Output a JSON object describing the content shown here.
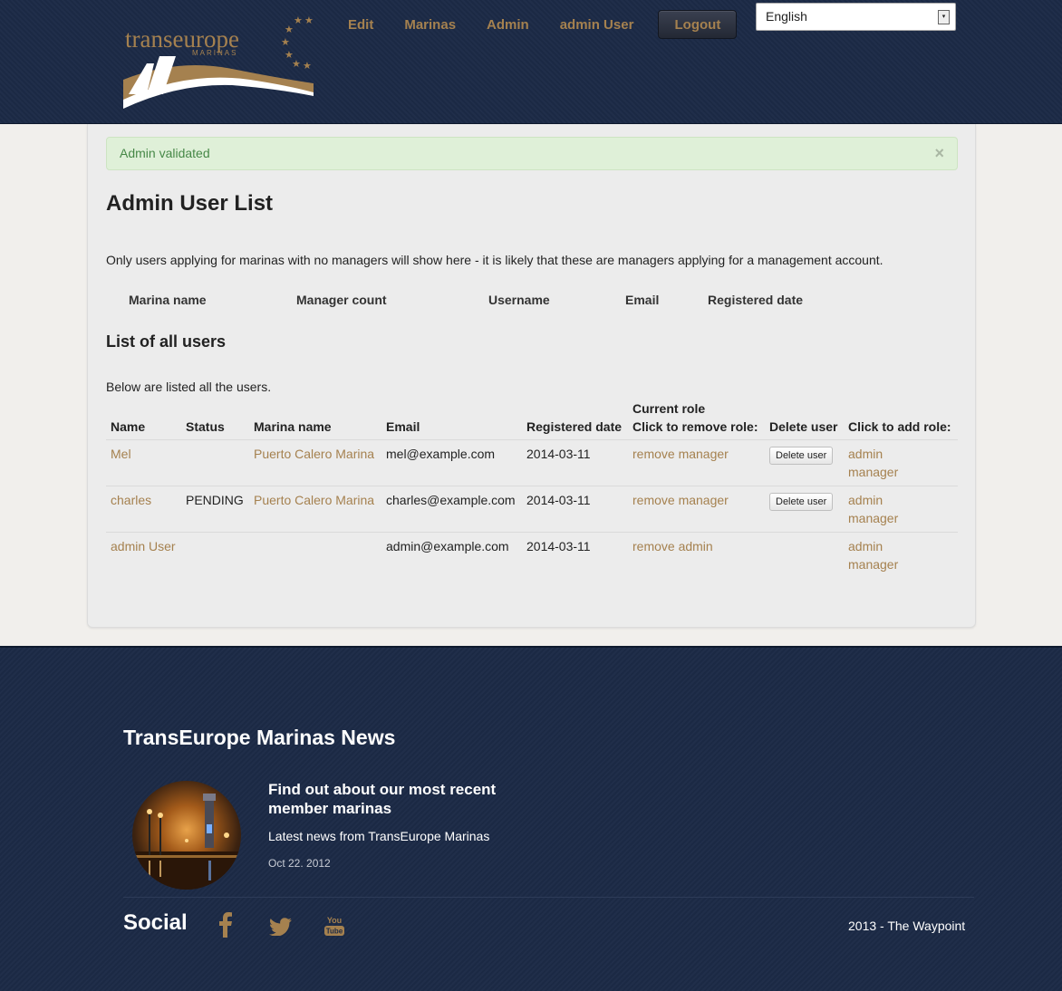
{
  "header": {
    "logo": {
      "main": "transeurope",
      "sub": "MARINAS"
    },
    "nav": [
      "Edit",
      "Marinas",
      "Admin",
      "admin User"
    ],
    "logout_label": "Logout",
    "language": {
      "selected": "English"
    }
  },
  "alert": {
    "message": "Admin validated",
    "close_glyph": "×"
  },
  "page": {
    "title": "Admin User List",
    "intro": "Only users applying for marinas with no managers will show here - it is likely that these are managers applying for a management account.",
    "applicant_headers": [
      "Marina name",
      "Manager count",
      "Username",
      "Email",
      "Registered date"
    ],
    "all_title": "List of all users",
    "all_intro": "Below are listed all the users."
  },
  "users_table": {
    "headers": {
      "name": "Name",
      "status": "Status",
      "marina": "Marina name",
      "email": "Email",
      "registered": "Registered date",
      "role_line1": "Current role",
      "role_line2": "Click to remove role:",
      "delete": "Delete user",
      "add_role": "Click to add role:"
    },
    "rows": [
      {
        "name": "Mel",
        "status": "",
        "marina": "Puerto Calero Marina",
        "email": "mel@example.com",
        "registered": "2014-03-11",
        "remove": "remove manager",
        "delete_label": "Delete user",
        "add1": "admin",
        "add2": "manager"
      },
      {
        "name": "charles",
        "status": "PENDING",
        "marina": "Puerto Calero Marina",
        "email": "charles@example.com",
        "registered": "2014-03-11",
        "remove": "remove manager",
        "delete_label": "Delete user",
        "add1": "admin",
        "add2": "manager"
      },
      {
        "name": "admin User",
        "status": "",
        "marina": "",
        "email": "admin@example.com",
        "registered": "2014-03-11",
        "remove": "remove admin",
        "delete_label": "",
        "add1": "admin",
        "add2": "manager"
      }
    ]
  },
  "footer": {
    "news_title": "TransEurope Marinas News",
    "news_heading": "Find out about our most recent member marinas",
    "news_sub": "Latest news from TransEurope Marinas",
    "news_date": "Oct 22. 2012",
    "social_title": "Social",
    "social_icons": [
      "facebook-icon",
      "twitter-icon",
      "youtube-icon"
    ],
    "youtube_text": {
      "top": "You",
      "bottom": "Tube"
    },
    "copyright": "2013 - The Waypoint"
  },
  "colors": {
    "navy": "#1c2a46",
    "accent": "#a5814f",
    "alert_bg": "#dff0d8",
    "alert_text": "#468847"
  }
}
